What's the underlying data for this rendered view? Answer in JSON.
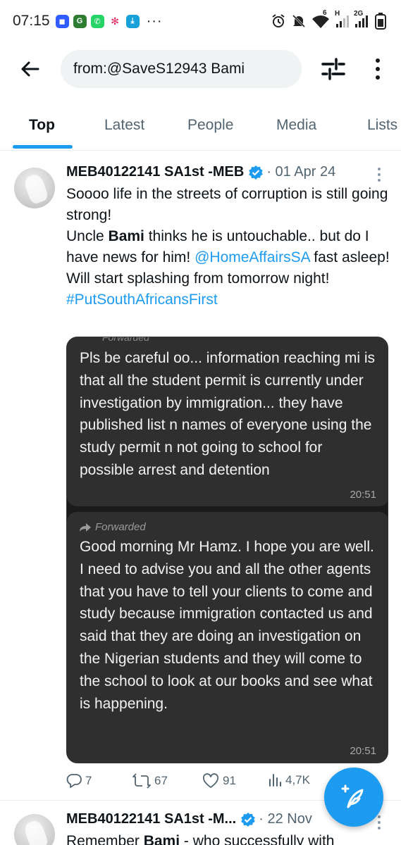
{
  "status_bar": {
    "time": "07:15",
    "more": "···",
    "network_6": "6",
    "network_h": "H",
    "network_2g": "2G"
  },
  "search": {
    "query": "from:@SaveS12943 Bami"
  },
  "tabs": [
    {
      "label": "Top",
      "active": true
    },
    {
      "label": "Latest",
      "active": false
    },
    {
      "label": "People",
      "active": false
    },
    {
      "label": "Media",
      "active": false
    },
    {
      "label": "Lists",
      "active": false
    }
  ],
  "tweets": [
    {
      "author": "MEB40122141 SA1st -MEB",
      "date": "· 01 Apr 24",
      "text": {
        "line1": "Soooo life in the streets of corruption is still going strong!",
        "line2_pre": "Uncle ",
        "line2_bold": "Bami",
        "line2_post": " thinks he is untouchable.. but do I have news for him! ",
        "mention": "@HomeAffairsSA",
        "line2_end": " fast asleep!  Will start splashing from tomorrow night!",
        "hashtag": "#PutSouthAfricansFirst"
      },
      "media": {
        "bubble1_forwarded": "Forwarded",
        "bubble1_text": "Pls be careful oo... information reaching mi is that all the student permit is currently under investigation by immigration... they have published list n names of everyone using the study permit n not going to school for possible arrest and detention",
        "bubble1_time": "20:51",
        "bubble2_forwarded": "Forwarded",
        "bubble2_text": "Good morning Mr Hamz. I hope you are well. I need to advise you and all the other agents that you have to tell your clients to come and study because immigration contacted us and said that they are doing an investigation on the Nigerian students and they will come to the school to look at our books and see what is happening.",
        "bubble2_time": "20:51"
      },
      "actions": {
        "replies": "7",
        "reposts": "67",
        "likes": "91",
        "views": "4,7K"
      }
    },
    {
      "author": "MEB40122141 SA1st -M...",
      "date": "· 22 Nov",
      "text_pre": "Remember ",
      "text_bold": "Bami",
      "text_post": " - who successfully with"
    }
  ],
  "colors": {
    "accent": "#1d9bf0",
    "text_primary": "#0f1419",
    "text_secondary": "#536471",
    "search_bg": "#eff3f4"
  }
}
